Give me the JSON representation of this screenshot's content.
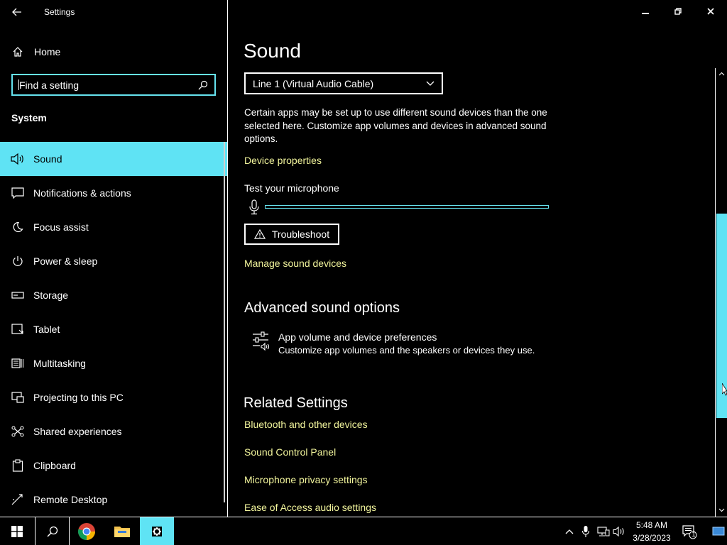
{
  "window": {
    "title": "Settings"
  },
  "sidebar": {
    "home_label": "Home",
    "search_placeholder": "Find a setting",
    "section": "System",
    "items": [
      {
        "label": "Sound",
        "icon": "speaker-icon",
        "active": true
      },
      {
        "label": "Notifications & actions",
        "icon": "notification-icon"
      },
      {
        "label": "Focus assist",
        "icon": "moon-icon"
      },
      {
        "label": "Power & sleep",
        "icon": "power-icon"
      },
      {
        "label": "Storage",
        "icon": "storage-icon"
      },
      {
        "label": "Tablet",
        "icon": "tablet-icon"
      },
      {
        "label": "Multitasking",
        "icon": "multitasking-icon"
      },
      {
        "label": "Projecting to this PC",
        "icon": "projecting-icon"
      },
      {
        "label": "Shared experiences",
        "icon": "shared-icon"
      },
      {
        "label": "Clipboard",
        "icon": "clipboard-icon"
      },
      {
        "label": "Remote Desktop",
        "icon": "remote-desktop-icon"
      }
    ]
  },
  "main": {
    "title": "Sound",
    "input_device": "Line 1 (Virtual Audio Cable)",
    "info_text": "Certain apps may be set up to use different sound devices than the one selected here. Customize app volumes and devices in advanced sound options.",
    "device_properties": "Device properties",
    "test_mic_label": "Test your microphone",
    "mic_level": 0,
    "troubleshoot": "Troubleshoot",
    "manage_devices": "Manage sound devices",
    "advanced_heading": "Advanced sound options",
    "app_volume_title": "App volume and device preferences",
    "app_volume_desc": "Customize app volumes and the speakers or devices they use.",
    "related_heading": "Related Settings",
    "related_links": [
      "Bluetooth and other devices",
      "Sound Control Panel",
      "Microphone privacy settings",
      "Ease of Access audio settings"
    ]
  },
  "taskbar": {
    "time": "5:48 AM",
    "date": "3/28/2023",
    "notification_count": "1"
  },
  "colors": {
    "accent": "#5fe3f4",
    "link": "#f2f59c",
    "background": "#000000"
  }
}
